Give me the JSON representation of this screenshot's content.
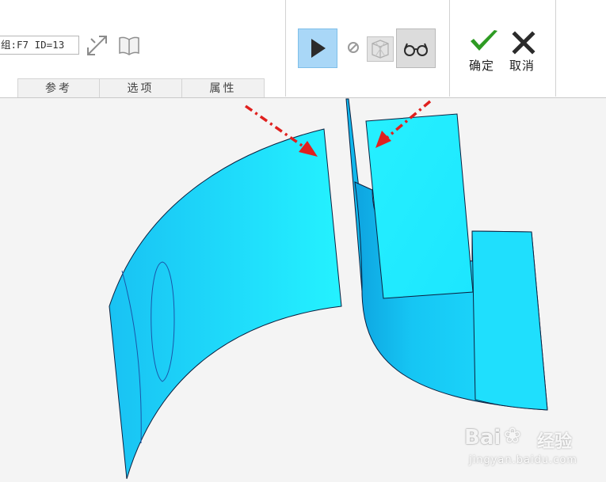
{
  "ribbon": {
    "reference_field_value": "组:F7 ID=13",
    "tabs": [
      {
        "label": "参考"
      },
      {
        "label": "选项"
      },
      {
        "label": "属性"
      }
    ],
    "ok_label": "确定",
    "cancel_label": "取消",
    "ok_color": "#2e9b23",
    "cancel_color": "#2b2b2b"
  },
  "viewport": {
    "surface_color": "#1ee8ff",
    "arrow_color": "#e0201e"
  },
  "watermark": {
    "brand": "Bai",
    "brand_suffix": "经验",
    "site": "jingyan.baidu.com"
  }
}
